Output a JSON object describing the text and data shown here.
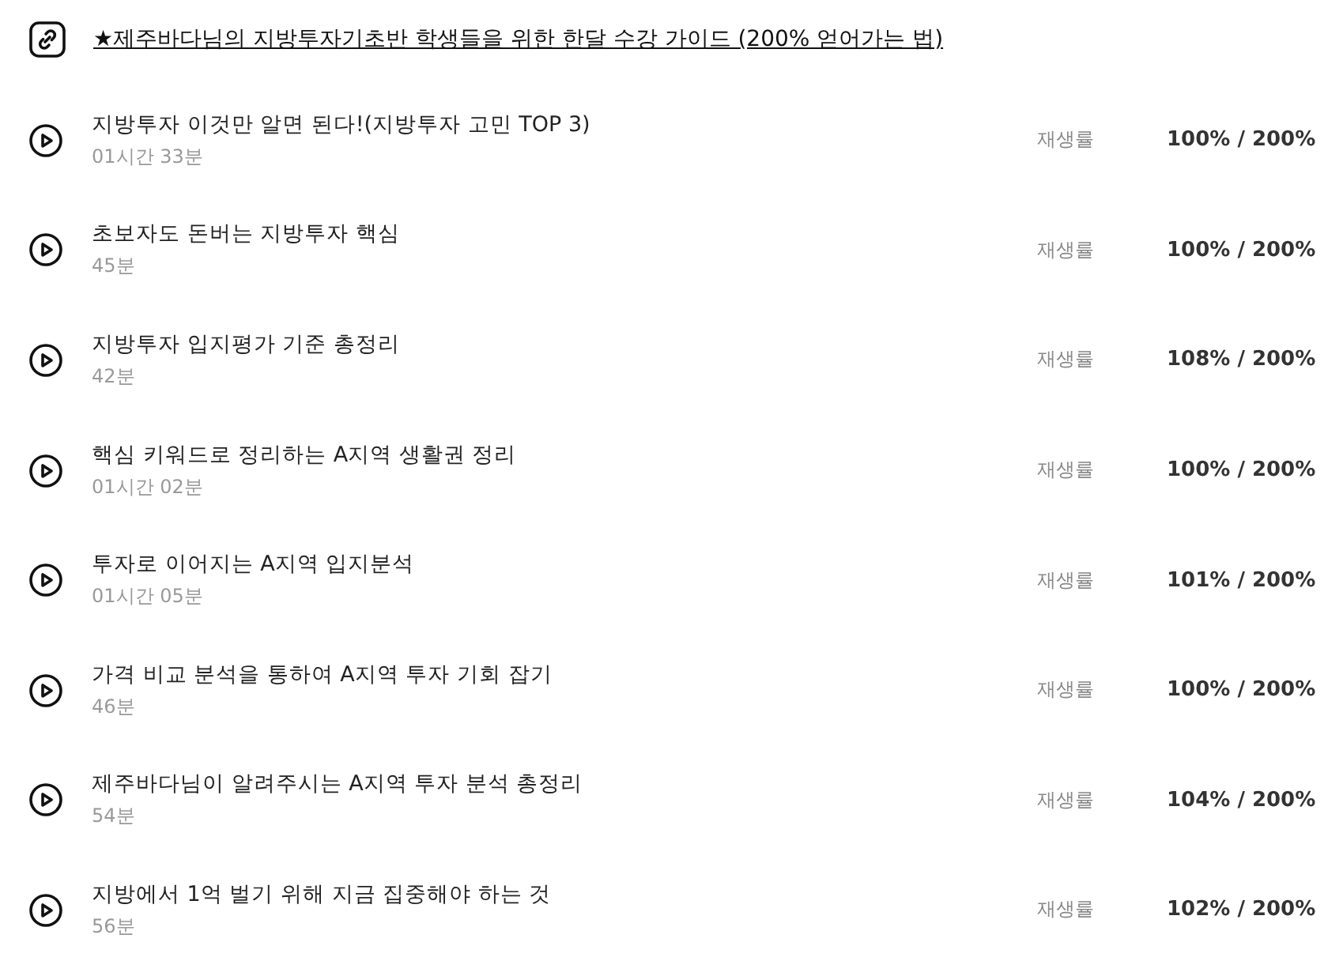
{
  "link": {
    "text": "★제주바다님의 지방투자기초반 학생들을 위한 한달 수강 가이드 (200% 얻어가는 법)"
  },
  "lessons": [
    {
      "title": "지방투자 이것만 알면 된다!(지방투자 고민 TOP 3)",
      "duration": "01시간 33분",
      "label": "재생률",
      "progress": "100% / 200%"
    },
    {
      "title": "초보자도 돈버는 지방투자 핵심",
      "duration": "45분",
      "label": "재생률",
      "progress": "100% / 200%"
    },
    {
      "title": "지방투자 입지평가 기준 총정리",
      "duration": "42분",
      "label": "재생률",
      "progress": "108% / 200%"
    },
    {
      "title": "핵심 키워드로 정리하는 A지역 생활권 정리",
      "duration": "01시간 02분",
      "label": "재생률",
      "progress": "100% / 200%"
    },
    {
      "title": "투자로 이어지는 A지역 입지분석",
      "duration": "01시간 05분",
      "label": "재생률",
      "progress": "101% / 200%"
    },
    {
      "title": "가격 비교 분석을 통하여 A지역 투자 기회 잡기",
      "duration": "46분",
      "label": "재생률",
      "progress": "100% / 200%"
    },
    {
      "title": "제주바다님이 알려주시는 A지역 투자 분석 총정리",
      "duration": "54분",
      "label": "재생률",
      "progress": "104% / 200%"
    },
    {
      "title": "지방에서 1억 벌기 위해 지금 집중해야 하는 것",
      "duration": "56분",
      "label": "재생률",
      "progress": "102% / 200%"
    }
  ]
}
